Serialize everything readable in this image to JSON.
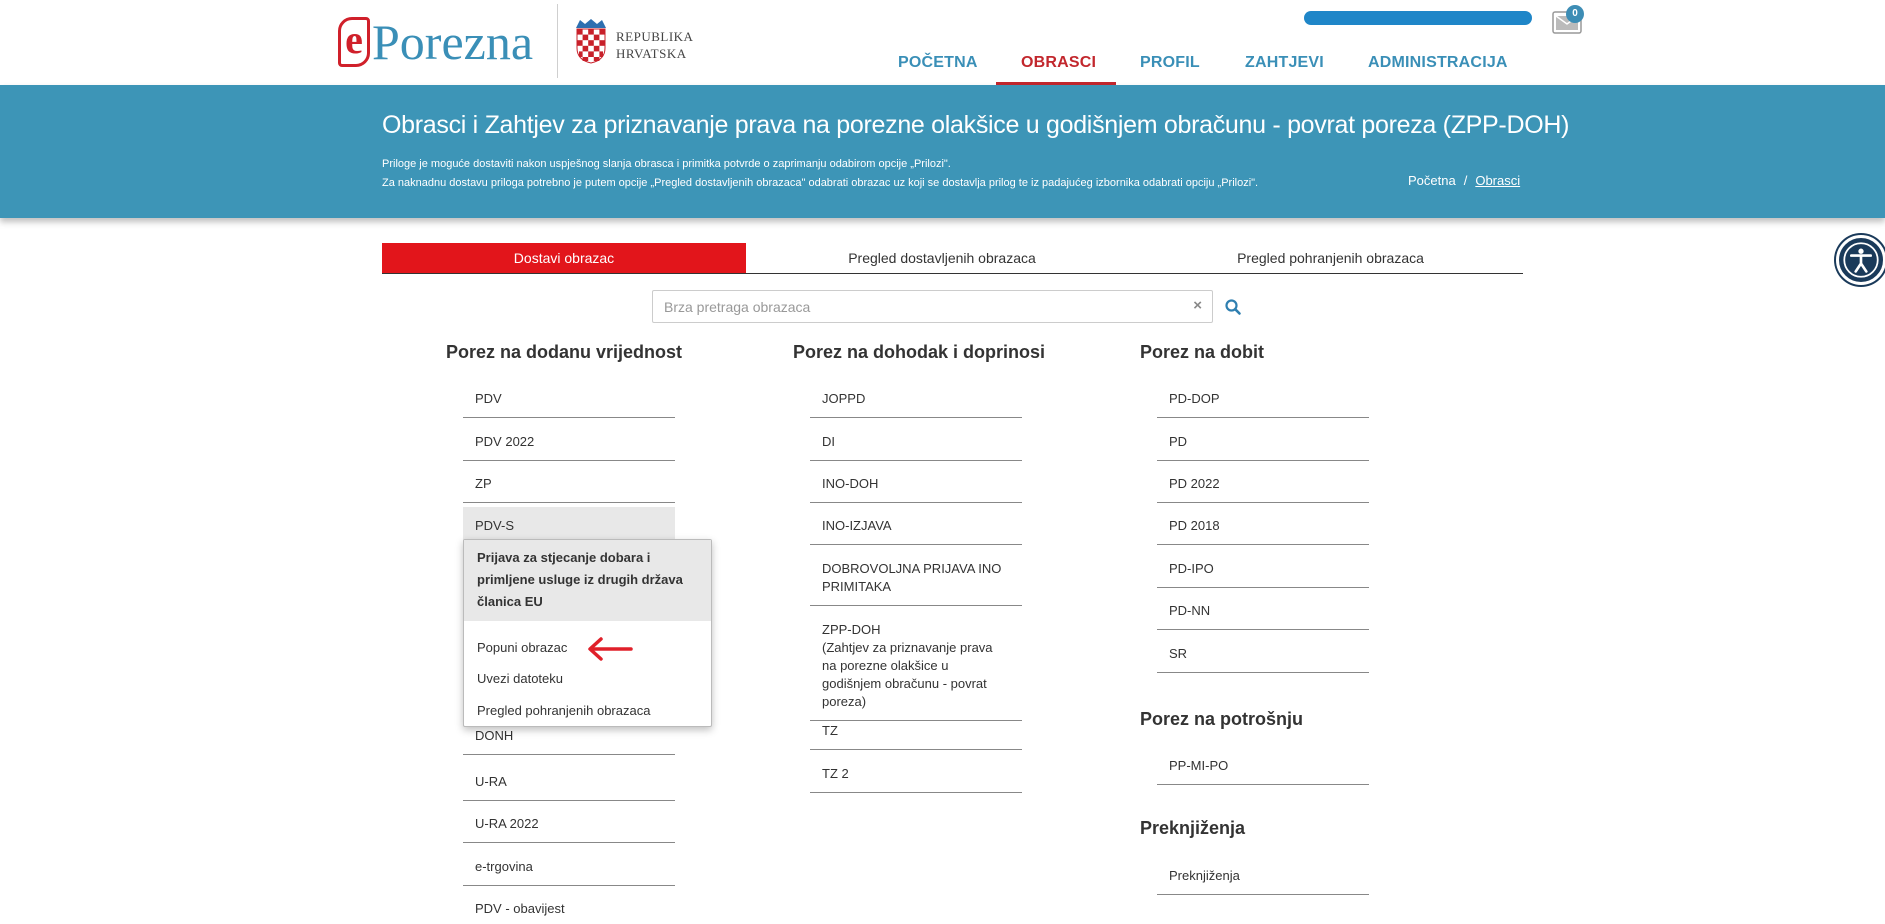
{
  "header": {
    "logo_e": "e",
    "logo_text": "Porezna",
    "republic_line1": "REPUBLIKA",
    "republic_line2": "HRVATSKA",
    "mail_count": "0"
  },
  "nav": {
    "items": [
      "POČETNA",
      "OBRASCI",
      "PROFIL",
      "ZAHTJEVI",
      "ADMINISTRACIJA"
    ],
    "active": "OBRASCI",
    "active_color": "#c2272d",
    "color": "#3a8fb7"
  },
  "banner": {
    "title": "Obrasci i Zahtjev za priznavanje prava na porezne olakšice u godišnjem obračunu - povrat poreza (ZPP-DOH)",
    "note_line1": "Priloge je moguće dostaviti nakon uspješnog slanja obrasca i primitka potvrde o zaprimanju odabirom opcije „Prilozi\".",
    "note_line2": "Za naknadnu dostavu priloga potrebno je putem opcije „Pregled dostavljenih obrazaca\" odabrati obrazac uz koji se dostavlja prilog te iz padajućeg izbornika odabrati opciju „Prilozi\".",
    "breadcrumb_home": "Početna",
    "breadcrumb_sep": "/",
    "breadcrumb_current": "Obrasci",
    "color": "#3d95b7"
  },
  "tabs": [
    "Dostavi obrazac",
    "Pregled dostavljenih obrazaca",
    "Pregled pohranjenih obrazaca"
  ],
  "search": {
    "placeholder": "Brza pretraga obrazaca",
    "clear": "×"
  },
  "columns": {
    "vat": {
      "title": "Porez na dodanu vrijednost",
      "items": [
        "PDV",
        "PDV 2022",
        "ZP",
        "PDV-S",
        "DONH",
        "U-RA",
        "U-RA 2022",
        "e-trgovina",
        "PDV - obavijest"
      ]
    },
    "income": {
      "title": "Porez na dohodak i doprinosi",
      "items": [
        "JOPPD",
        "DI",
        "INO-DOH",
        "INO-IZJAVA",
        "DOBROVOLJNA PRIJAVA INO PRIMITAKA",
        "ZPP-DOH",
        "TZ",
        "TZ 2"
      ],
      "zpp_note": "(Zahtjev za priznavanje prava na porezne olakšice u godišnjem obračunu - povrat poreza)"
    },
    "profit": {
      "title": "Porez na dobit",
      "items": [
        "PD-DOP",
        "PD",
        "PD 2022",
        "PD 2018",
        "PD-IPO",
        "PD-NN",
        "SR"
      ]
    },
    "consumption": {
      "title": "Porez na potrošnju",
      "items": [
        "PP-MI-PO"
      ]
    },
    "rebooking": {
      "title": "Preknjiženja",
      "items": [
        "Preknjiženja"
      ]
    }
  },
  "popup": {
    "heading": "Prijava za stjecanje dobara i primljene usluge iz drugih država članica EU",
    "links": [
      "Popuni obrazac",
      "Uvezi datoteku",
      "Pregled pohranjenih obrazaca"
    ]
  },
  "colors": {
    "accent_red": "#e2151b",
    "arrow_red": "#e0202a"
  }
}
